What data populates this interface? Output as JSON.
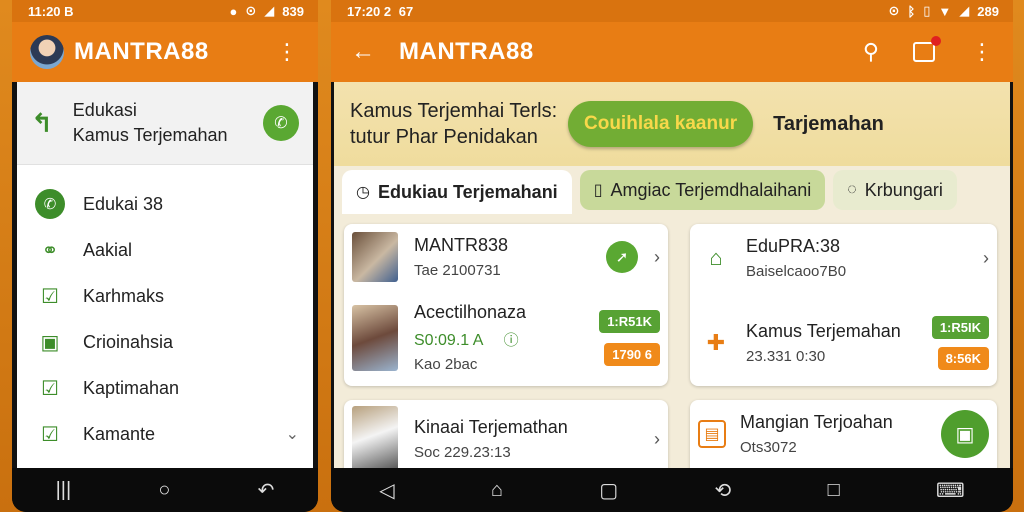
{
  "left": {
    "status": {
      "time": "11:20 B",
      "battery": "839"
    },
    "app_title": "MANTRA88",
    "header": {
      "line1": "Edukasi",
      "line2": "Kamus Terjemahan"
    },
    "menu": [
      {
        "label": "Edukai 38",
        "icon": "whatsapp-icon"
      },
      {
        "label": "Aakial",
        "icon": "share-icon"
      },
      {
        "label": "Karhmaks",
        "icon": "edit-icon"
      },
      {
        "label": "Crioinahsia",
        "icon": "calendar-icon"
      },
      {
        "label": "Kaptimahan",
        "icon": "note-icon"
      },
      {
        "label": "Kamante",
        "icon": "checklist-icon"
      }
    ]
  },
  "right": {
    "status": {
      "time": "17:20 2",
      "net": "67",
      "battery": "289"
    },
    "app_title": "MANTRA88",
    "hero": {
      "line1": "Kamus Terjemhai Terls:",
      "line2": "tutur Phar Penidakan",
      "pill": "Couihlala kaanur",
      "label": "Tarjemahan"
    },
    "tabs": [
      {
        "label": "Edukiau Terjemahani"
      },
      {
        "label": "Amgiac Terjemdhalaihani"
      },
      {
        "label": "Krbungari"
      }
    ],
    "card1": {
      "row1": {
        "title": "MANTR838",
        "sub": "Tae 2100731"
      },
      "row2": {
        "title": "Acectilhonaza",
        "sub": "S0:09.1 A",
        "sub2": "Kao 2bac",
        "badge1": "1:R51K",
        "badge2": "1790 6"
      }
    },
    "card2": {
      "row1": {
        "title": "EduPRA:38",
        "sub": "Baiselcaoo7B0"
      },
      "row2": {
        "title": "Kamus Terjemahan",
        "sub": "23.331 0:30",
        "badge1": "1:R5IK",
        "badge2": "8:56K"
      }
    },
    "card3": {
      "title": "Kinaai Terjemathan",
      "sub": "Soc 229.23:13"
    },
    "card4": {
      "title": "Mangian Terjoahan",
      "sub": "Ots3072"
    }
  }
}
